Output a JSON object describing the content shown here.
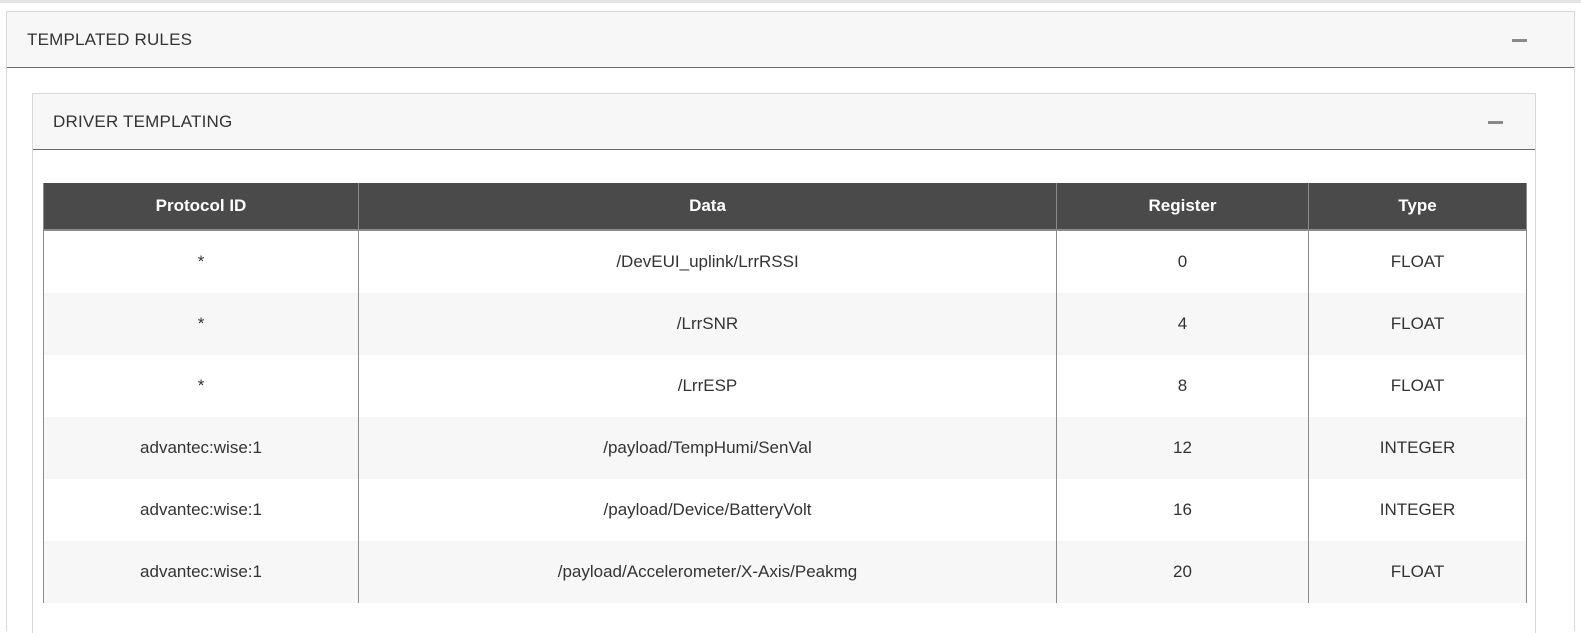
{
  "panels": {
    "outer_title": "TEMPLATED RULES",
    "inner_title": "DRIVER TEMPLATING"
  },
  "table": {
    "headers": [
      "Protocol ID",
      "Data",
      "Register",
      "Type"
    ],
    "rows": [
      [
        "*",
        "/DevEUI_uplink/LrrRSSI",
        "0",
        "FLOAT"
      ],
      [
        "*",
        "/LrrSNR",
        "4",
        "FLOAT"
      ],
      [
        "*",
        "/LrrESP",
        "8",
        "FLOAT"
      ],
      [
        "advantec:wise:1",
        "/payload/TempHumi/SenVal",
        "12",
        "INTEGER"
      ],
      [
        "advantec:wise:1",
        "/payload/Device/BatteryVolt",
        "16",
        "INTEGER"
      ],
      [
        "advantec:wise:1",
        "/payload/Accelerometer/X-Axis/Peakmg",
        "20",
        "FLOAT"
      ]
    ]
  },
  "icons": {
    "collapse": "minus-icon"
  },
  "colors": {
    "table_header_bg": "#4a4a4a",
    "panel_header_bg": "#f7f7f7",
    "stripe_bg": "#f7f7f7"
  }
}
